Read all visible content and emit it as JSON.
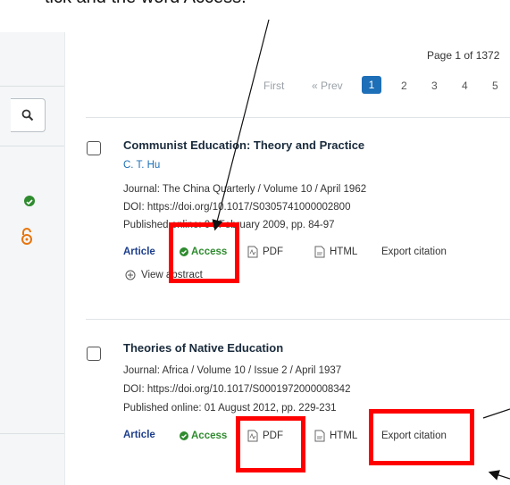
{
  "caption": {
    "text": "tick and the word Access."
  },
  "sidebar": {
    "search_icon": "search-icon",
    "access_icon": "check-circle-icon",
    "open_access_icon": "open-access-lock-icon"
  },
  "pagination": {
    "summary": "Page 1 of 1372",
    "first": "First",
    "prev": "« Prev",
    "pages": [
      "1",
      "2",
      "3",
      "4",
      "5"
    ],
    "current": "1"
  },
  "results": [
    {
      "title": "Communist Education: Theory and Practice",
      "author": "C. T. Hu",
      "journal": "Journal: The China Quarterly / Volume 10 / April 1962",
      "doi": "DOI: https://doi.org/10.1017/S0305741000002800",
      "published": "Published online: 04 February 2009, pp. 84-97",
      "type": "Article",
      "access": "Access",
      "pdf": "PDF",
      "html": "HTML",
      "export": "Export citation",
      "view_abstract": "View abstract"
    },
    {
      "title": "Theories of Native Education",
      "journal": "Journal: Africa / Volume 10 / Issue 2 / April 1937",
      "doi": "DOI: https://doi.org/10.1017/S0001972000008342",
      "published": "Published online: 01 August 2012, pp. 229-231",
      "type": "Article",
      "access": "Access",
      "pdf": "PDF",
      "html": "HTML",
      "export": "Export citation"
    }
  ],
  "colors": {
    "annotation_red": "#ff0000",
    "access_green": "#2e8b2e",
    "link_blue": "#1d6fb8",
    "open_access_orange": "#e8740c"
  }
}
